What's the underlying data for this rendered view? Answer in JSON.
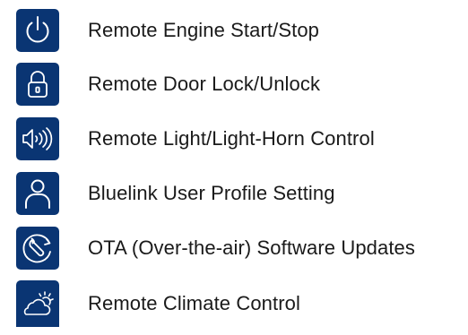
{
  "features": [
    {
      "label": "Remote Engine Start/Stop",
      "icon": "power-icon"
    },
    {
      "label": "Remote Door Lock/Unlock",
      "icon": "lock-icon"
    },
    {
      "label": "Remote Light/Light-Horn Control",
      "icon": "horn-sound-icon"
    },
    {
      "label": "Bluelink User Profile Setting",
      "icon": "user-profile-icon"
    },
    {
      "label": "OTA (Over-the-air) Software Updates",
      "icon": "wrench-update-icon"
    },
    {
      "label": "Remote Climate Control",
      "icon": "cloud-sun-icon"
    }
  ],
  "colors": {
    "icon_background": "#0a3573",
    "icon_foreground": "#ffffff",
    "text": "#1a1a1a"
  }
}
